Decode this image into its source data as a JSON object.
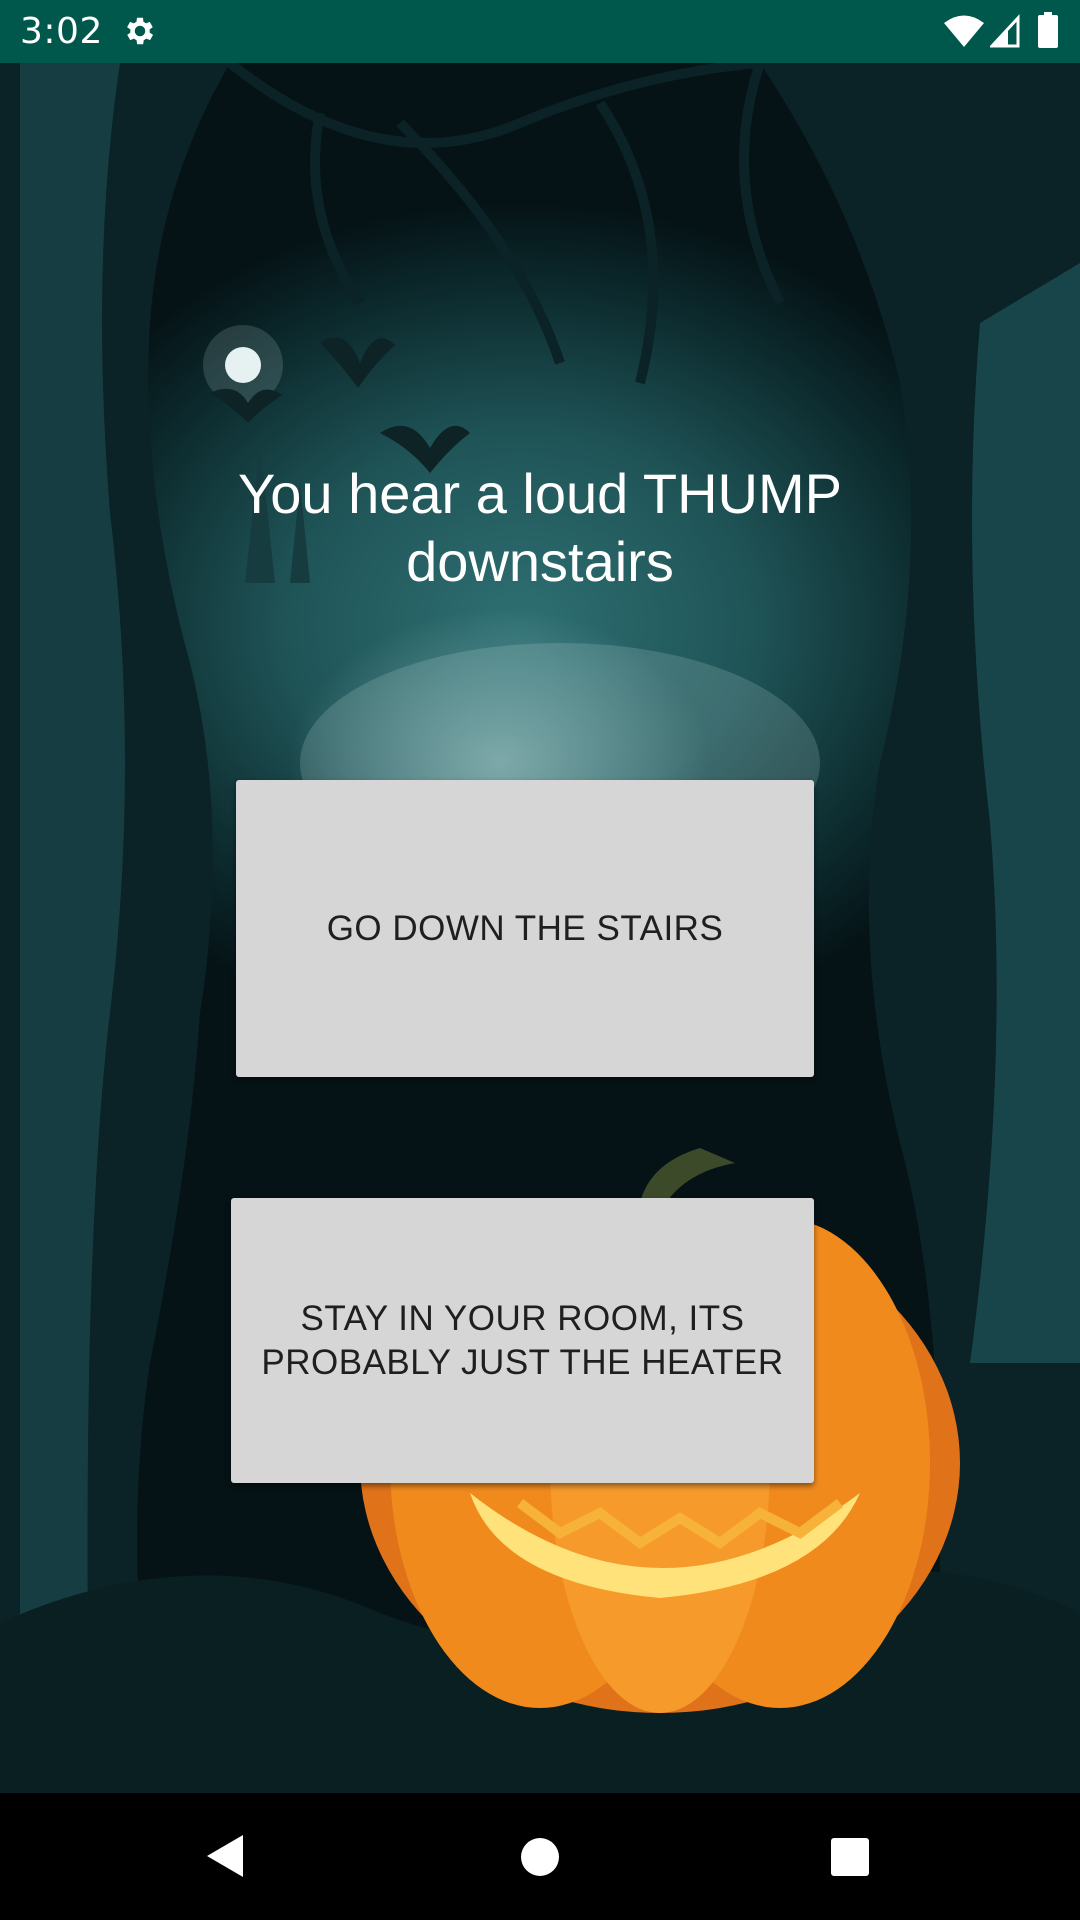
{
  "status_bar": {
    "time": "3:02",
    "icons": [
      "gear-icon",
      "wifi-icon",
      "signal-icon",
      "battery-icon"
    ],
    "background_color": "#00574b"
  },
  "story": {
    "text": "You hear a loud THUMP downstairs"
  },
  "choices": {
    "option_1": "GO DOWN THE STAIRS",
    "option_2": "STAY IN YOUR ROOM, ITS PROBABLY JUST THE HEATER"
  },
  "nav_bar": {
    "icons": [
      "back-icon",
      "home-icon",
      "recents-icon"
    ]
  },
  "colors": {
    "button_bg": "#d6d6d6",
    "button_text": "#1f1f1f",
    "scene_teal": "#1f5457",
    "pumpkin_orange": "#f08a1c"
  }
}
